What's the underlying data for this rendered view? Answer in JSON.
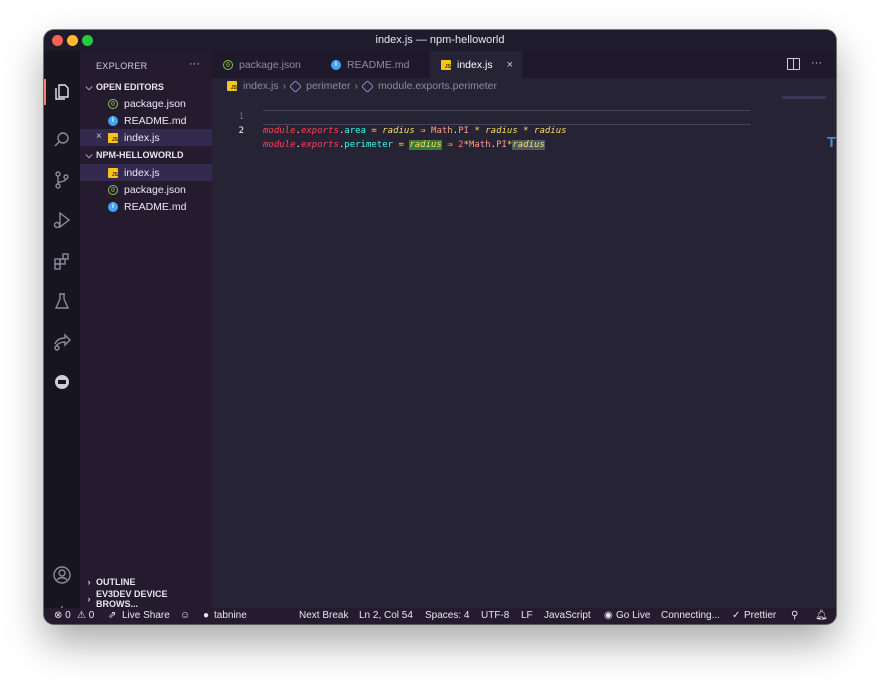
{
  "window": {
    "title": "index.js — npm-helloworld"
  },
  "activity_bar": {
    "icons": [
      "files-icon",
      "search-icon",
      "source-control-icon",
      "run-debug-icon",
      "extensions-icon",
      "testing-icon",
      "live-share-icon",
      "remote-icon",
      "account-icon",
      "settings-gear-icon"
    ]
  },
  "sidebar": {
    "header": "EXPLORER",
    "more": "···",
    "open_editors": {
      "label": "OPEN EDITORS",
      "items": [
        {
          "name": "package.json",
          "icon": "json-file-icon"
        },
        {
          "name": "README.md",
          "icon": "info-file-icon"
        },
        {
          "name": "index.js",
          "icon": "js-file-icon",
          "selected": true,
          "close": "×"
        }
      ]
    },
    "project": {
      "label": "NPM-HELLOWORLD",
      "items": [
        {
          "name": "index.js",
          "icon": "js-file-icon",
          "selected": true
        },
        {
          "name": "package.json",
          "icon": "json-file-icon"
        },
        {
          "name": "README.md",
          "icon": "info-file-icon"
        }
      ]
    },
    "outline": "OUTLINE",
    "ev3dev": "EV3DEV DEVICE BROWS..."
  },
  "tabs": [
    {
      "label": "package.json",
      "icon": "json-file-icon",
      "active": false
    },
    {
      "label": "README.md",
      "icon": "info-file-icon",
      "active": false
    },
    {
      "label": "index.js",
      "icon": "js-file-icon",
      "active": true,
      "close": "×"
    }
  ],
  "tab_more": "···",
  "breadcrumb": {
    "file": "index.js",
    "symbol1": "perimeter",
    "symbol2": "module.exports.perimeter"
  },
  "editor": {
    "lines": [
      {
        "number": "1",
        "tokens": [
          {
            "t": "module",
            "c": "tk-obj"
          },
          {
            "t": ".",
            "c": "tk-plain"
          },
          {
            "t": "exports",
            "c": "tk-obj"
          },
          {
            "t": ".",
            "c": "tk-plain"
          },
          {
            "t": "area",
            "c": "tk-fn"
          },
          {
            "t": " = ",
            "c": "tk-op"
          },
          {
            "t": "radius",
            "c": "tk-param"
          },
          {
            "t": " ⇒ ",
            "c": "tk-op"
          },
          {
            "t": "Math",
            "c": "tk-math"
          },
          {
            "t": ".",
            "c": "tk-plain"
          },
          {
            "t": "PI",
            "c": "tk-math"
          },
          {
            "t": " * ",
            "c": "tk-op"
          },
          {
            "t": "radius",
            "c": "tk-param"
          },
          {
            "t": " * ",
            "c": "tk-op"
          },
          {
            "t": "radius",
            "c": "tk-param"
          }
        ]
      },
      {
        "number": "2",
        "tokens": [
          {
            "t": "module",
            "c": "tk-obj"
          },
          {
            "t": ".",
            "c": "tk-plain"
          },
          {
            "t": "exports",
            "c": "tk-obj"
          },
          {
            "t": ".",
            "c": "tk-plain"
          },
          {
            "t": "perimeter",
            "c": "tk-fn"
          },
          {
            "t": " = ",
            "c": "tk-op"
          },
          {
            "t": "radius",
            "c": "tk-param hl"
          },
          {
            "t": " ⇒ ",
            "c": "tk-op"
          },
          {
            "t": "2",
            "c": "tk-num"
          },
          {
            "t": "*",
            "c": "tk-op"
          },
          {
            "t": "Math",
            "c": "tk-math"
          },
          {
            "t": ".",
            "c": "tk-plain"
          },
          {
            "t": "PI",
            "c": "tk-math"
          },
          {
            "t": "*",
            "c": "tk-op"
          },
          {
            "t": "radius",
            "c": "tk-param hl2"
          }
        ]
      }
    ],
    "minimap_letter": "T"
  },
  "statusbar": {
    "errors": "⊗ 0",
    "warnings": "⚠ 0",
    "live_share": "Live Share",
    "feedback": "☺",
    "tabnine": "tabnine",
    "next_break": "Next Break",
    "position": "Ln 2, Col 54",
    "spaces": "Spaces: 4",
    "encoding": "UTF-8",
    "eol": "LF",
    "language": "JavaScript",
    "go_live": "Go Live",
    "connecting": "Connecting...",
    "prettier": "Prettier"
  }
}
